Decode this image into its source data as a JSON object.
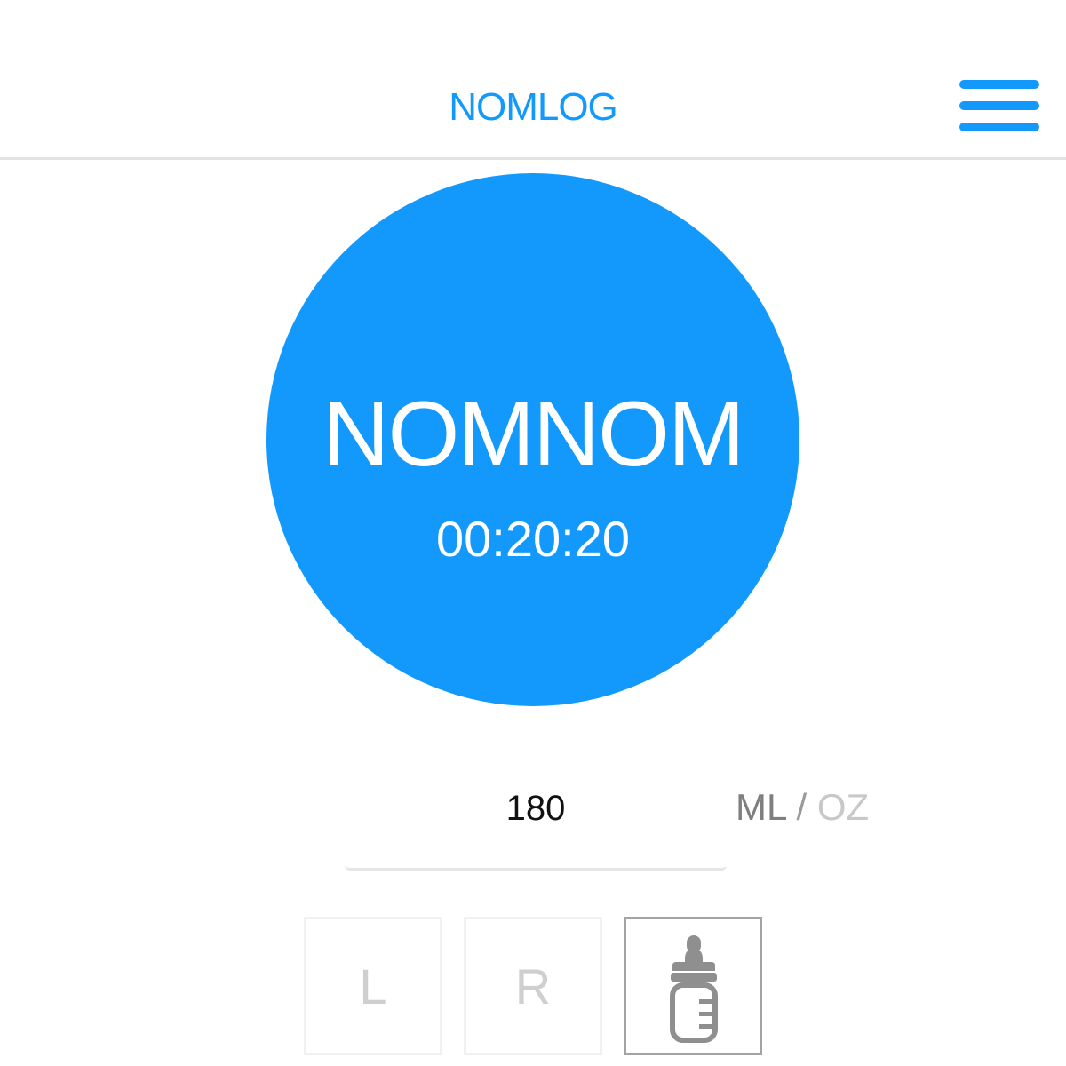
{
  "theme": {
    "accent": "#1399fb"
  },
  "header": {
    "title": "NOMLOG",
    "menu_icon": "hamburger-menu-icon"
  },
  "timer": {
    "label": "NOMNOM",
    "elapsed": "00:20:20"
  },
  "amount": {
    "value": "180",
    "unit_primary": "ML",
    "unit_separator": "/",
    "unit_secondary": "OZ",
    "selected_unit": "ML"
  },
  "feed_type": {
    "left_label": "L",
    "right_label": "R",
    "bottle_icon": "bottle-icon",
    "selected": "bottle"
  }
}
